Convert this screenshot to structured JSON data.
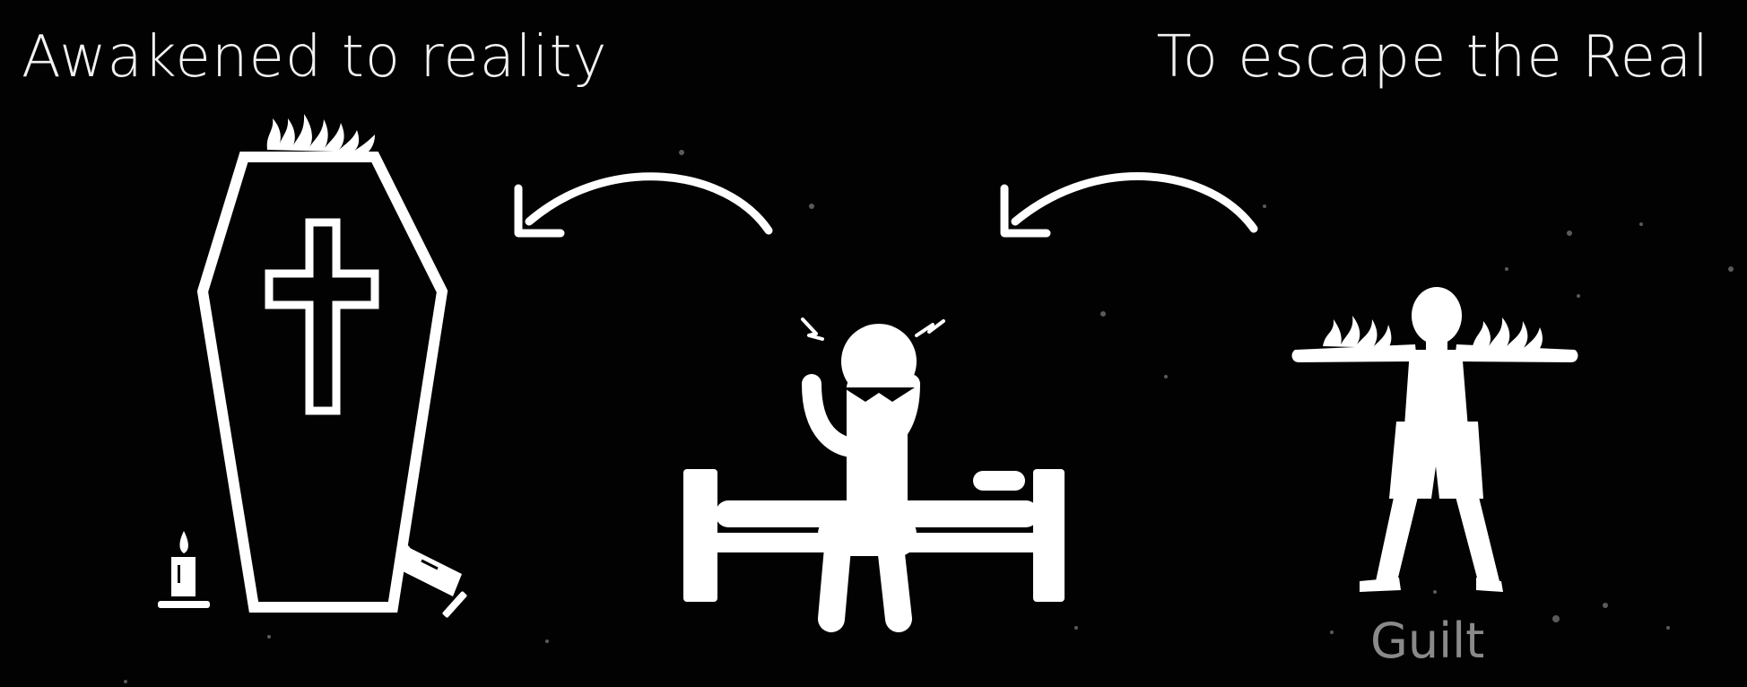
{
  "diagram": {
    "caption_left": "Awakened to reality",
    "caption_right": "To escape the Real",
    "label_guilt": "Guilt",
    "icons": [
      "coffin-icon",
      "cross-icon",
      "flames-icon",
      "candle-icon",
      "fallen-candle-icon",
      "distressed-person-on-bed-icon",
      "burning-child-figure-icon"
    ],
    "arrows": [
      "arrow-from-figure-to-bed",
      "arrow-from-bed-to-coffin"
    ],
    "colors": {
      "background": "#020202",
      "foreground": "#ffffff",
      "label": "#8a8a8a"
    }
  }
}
